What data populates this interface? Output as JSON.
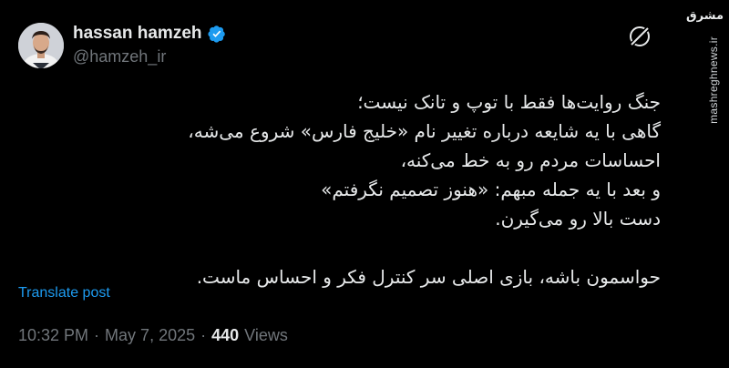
{
  "author": {
    "name": "hassan hamzeh",
    "handle": "@hamzeh_ir",
    "verified_icon": "verified-badge-icon",
    "avatar_icon": "avatar"
  },
  "tweet": {
    "text": "جنگ روایت‌ها فقط با توپ و تانک نیست؛\nگاهی با یه شایعه درباره تغییر نام «خلیج فارس» شروع می‌شه،\nاحساسات مردم رو به خط می‌کنه،\nو بعد با یه جمله مبهم: «هنوز تصمیم نگرفتم»\nدست بالا رو می‌گیرن.\n\nحواسمون باشه، بازی اصلی سر کنترل فکر و احساس  ماست.",
    "translate_label": "Translate post",
    "time": "10:32 PM",
    "sep1": "·",
    "date": "May 7, 2025",
    "sep2": "·",
    "views_count": "440",
    "views_label": "Views"
  },
  "watermark": {
    "logo_text": "مشرق",
    "url": "mashreghnews.ir"
  },
  "colors": {
    "background": "#000000",
    "text": "#e7e9ea",
    "muted": "#71767b",
    "link": "#1d9bf0",
    "verified": "#1d9bf0"
  }
}
